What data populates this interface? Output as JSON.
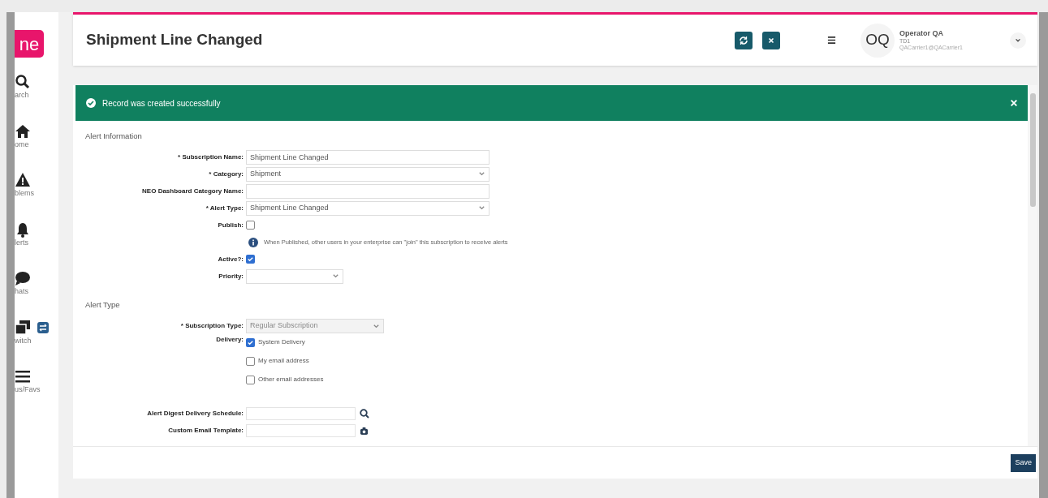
{
  "sidebar": {
    "logo_text": "ne",
    "items": [
      {
        "label": "arch"
      },
      {
        "label": "ome"
      },
      {
        "label": "blems"
      },
      {
        "label": "lerts"
      },
      {
        "label": "hats"
      },
      {
        "label": "witch"
      },
      {
        "label": "us/Favs"
      }
    ]
  },
  "header": {
    "title": "Shipment Line Changed",
    "avatar": "OQ",
    "user_name": "Operator QA",
    "user_org": "TD1",
    "user_email": "QACarrier1@QACarrier1"
  },
  "banner": {
    "message": "Record was created successfully"
  },
  "sections": [
    {
      "title": "Alert Information",
      "fields": [
        {
          "kind": "text",
          "label": "* Subscription Name:",
          "value": "Shipment Line Changed"
        },
        {
          "kind": "select",
          "label": "* Category:",
          "value": "Shipment"
        },
        {
          "kind": "text",
          "label": "NEO Dashboard Category Name:"
        },
        {
          "kind": "select",
          "label": "* Alert Type:",
          "value": "Shipment Line Changed"
        },
        {
          "kind": "checkbox",
          "label": "Publish:",
          "checked": false
        },
        {
          "kind": "info",
          "text": "When Published, other users in your enterprise can \"join\" this subscription to receive alerts"
        },
        {
          "kind": "checkbox",
          "label": "Active?:",
          "checked": true
        },
        {
          "kind": "select",
          "label": "Priority:"
        }
      ]
    },
    {
      "title": "Alert Type",
      "fields": [
        {
          "kind": "select",
          "label": "* Subscription Type:",
          "value": "Regular Subscription",
          "disabled": true
        },
        {
          "kind": "options",
          "label": "Delivery:",
          "options": [
            {
              "label": "System Delivery",
              "checked": true
            },
            {
              "label": "My email address",
              "checked": false
            },
            {
              "label": "Other email addresses",
              "checked": false
            }
          ]
        },
        {
          "kind": "spacer"
        },
        {
          "kind": "lookup",
          "label": "Alert Digest Delivery Schedule:"
        },
        {
          "kind": "lookup",
          "label": "Custom Email Template:"
        }
      ]
    }
  ],
  "footer": {
    "save": "Save"
  }
}
